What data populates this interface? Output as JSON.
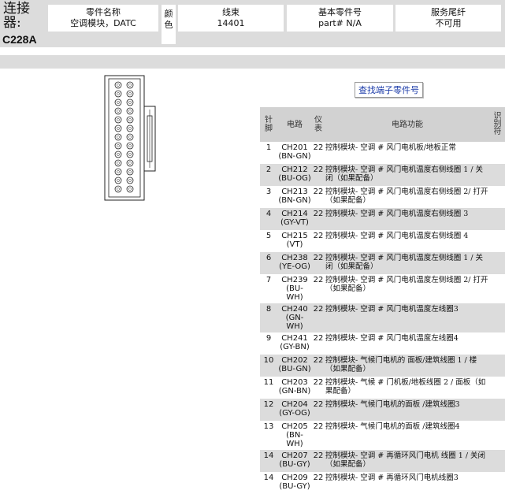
{
  "header": {
    "connector_label": "连接器:",
    "connector_code": "C228A",
    "part_name_label": "零件名称",
    "part_name_value": "空调模块，DATC",
    "color_label": "颜色",
    "harness_label": "线束",
    "harness_value": "14401",
    "base_part_label": "基本零件号",
    "base_part_value": "part# N/A",
    "pigtail_label": "服务尾纤",
    "pigtail_value": "不可用"
  },
  "find_terminal_link": "查找端子零件号",
  "table": {
    "headers": {
      "pin": "针脚",
      "circuit": "电路",
      "gauge": "仪表",
      "function": "电路功能",
      "id": "识别符"
    },
    "rows": [
      {
        "pin": "1",
        "circuit": "CH201 (BN-GN)",
        "gauge": "22",
        "function": "控制模块- 空调 # 风门电机板/地板正常"
      },
      {
        "pin": "2",
        "circuit": "CH212 (BU-OG)",
        "gauge": "22",
        "function": "控制模块- 空调 # 风门电机温度右侧线圈 1 / 关闭（如果配备）"
      },
      {
        "pin": "3",
        "circuit": "CH213 (BN-GN)",
        "gauge": "22",
        "function": "控制模块- 空调 # 风门电机温度右侧线圈 2/ 打开（如果配备）"
      },
      {
        "pin": "4",
        "circuit": "CH214 (GY-VT)",
        "gauge": "22",
        "function": "控制模块- 空调 # 风门电机温度右侧线圈 3"
      },
      {
        "pin": "5",
        "circuit": "CH215 (VT)",
        "gauge": "22",
        "function": "控制模块- 空调 # 风门电机温度右侧线圈 4"
      },
      {
        "pin": "6",
        "circuit": "CH238 (YE-OG)",
        "gauge": "22",
        "function": "控制模块- 空调 # 风门电机温度左侧线圈 1 / 关闭（如果配备）"
      },
      {
        "pin": "7",
        "circuit": "CH239 (BU-WH)",
        "gauge": "22",
        "function": "控制模块- 空调 # 风门电机温度左侧线圈 2/ 打开（如果配备）"
      },
      {
        "pin": "8",
        "circuit": "CH240 (GN-WH)",
        "gauge": "22",
        "function": "控制模块- 空调 # 风门电机温度左线圈3"
      },
      {
        "pin": "9",
        "circuit": "CH241 (GY-BN)",
        "gauge": "22",
        "function": "控制模块- 空调 # 风门电机温度左线圈4"
      },
      {
        "pin": "10",
        "circuit": "CH202 (BU-GN)",
        "gauge": "22",
        "function": "控制模块- 气候门电机的 面板/建筑线圈 1 / 楼（如果配备）"
      },
      {
        "pin": "11",
        "circuit": "CH203 (GN-BN)",
        "gauge": "22",
        "function": "控制模块- 气候 # 门机板/地板线圈 2 / 面板（如果配备）"
      },
      {
        "pin": "12",
        "circuit": "CH204 (GY-OG)",
        "gauge": "22",
        "function": "控制模块- 气候门电机的面板 /建筑线圈3"
      },
      {
        "pin": "13",
        "circuit": "CH205 (BN-WH)",
        "gauge": "22",
        "function": "控制模块- 气候门电机的面板 /建筑线圈4"
      },
      {
        "pin": "14",
        "circuit": "CH207 (BU-GY)",
        "gauge": "22",
        "function": "控制模块- 空调 # 再循环风门电机 线圈 1 / 关闭（如果配备）"
      },
      {
        "pin": "14",
        "circuit": "CH209 (BU-GY)",
        "gauge": "22",
        "function": "控制模块- 空调 # 再循环风门电机线圈3"
      }
    ]
  }
}
